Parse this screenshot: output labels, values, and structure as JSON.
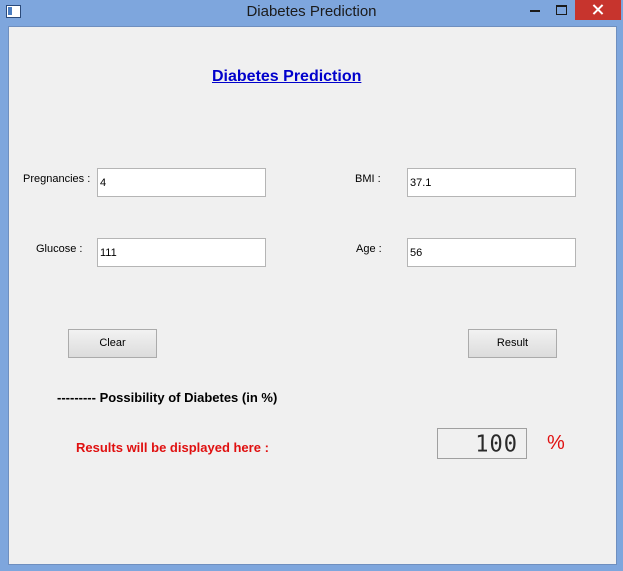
{
  "window": {
    "title": "Diabetes Prediction"
  },
  "heading": "Diabetes Prediction",
  "fields": {
    "pregnancies": {
      "label": "Pregnancies :",
      "value": "4"
    },
    "glucose": {
      "label": "Glucose :",
      "value": "111"
    },
    "bmi": {
      "label": "BMI :",
      "value": "37.1"
    },
    "age": {
      "label": "Age :",
      "value": "56"
    }
  },
  "buttons": {
    "clear": "Clear",
    "result": "Result"
  },
  "possibility_label": "--------- Possibility of Diabetes (in %)",
  "results_label": "Results will be displayed here :",
  "result_value": "100",
  "percent_sign": "%",
  "colors": {
    "heading": "#0000cc",
    "result_text": "#e01010",
    "titlebar": "#7ea6dd",
    "close_button": "#c7342d"
  },
  "icons": [
    "app-icon",
    "minimize-icon",
    "maximize-icon",
    "close-icon"
  ]
}
